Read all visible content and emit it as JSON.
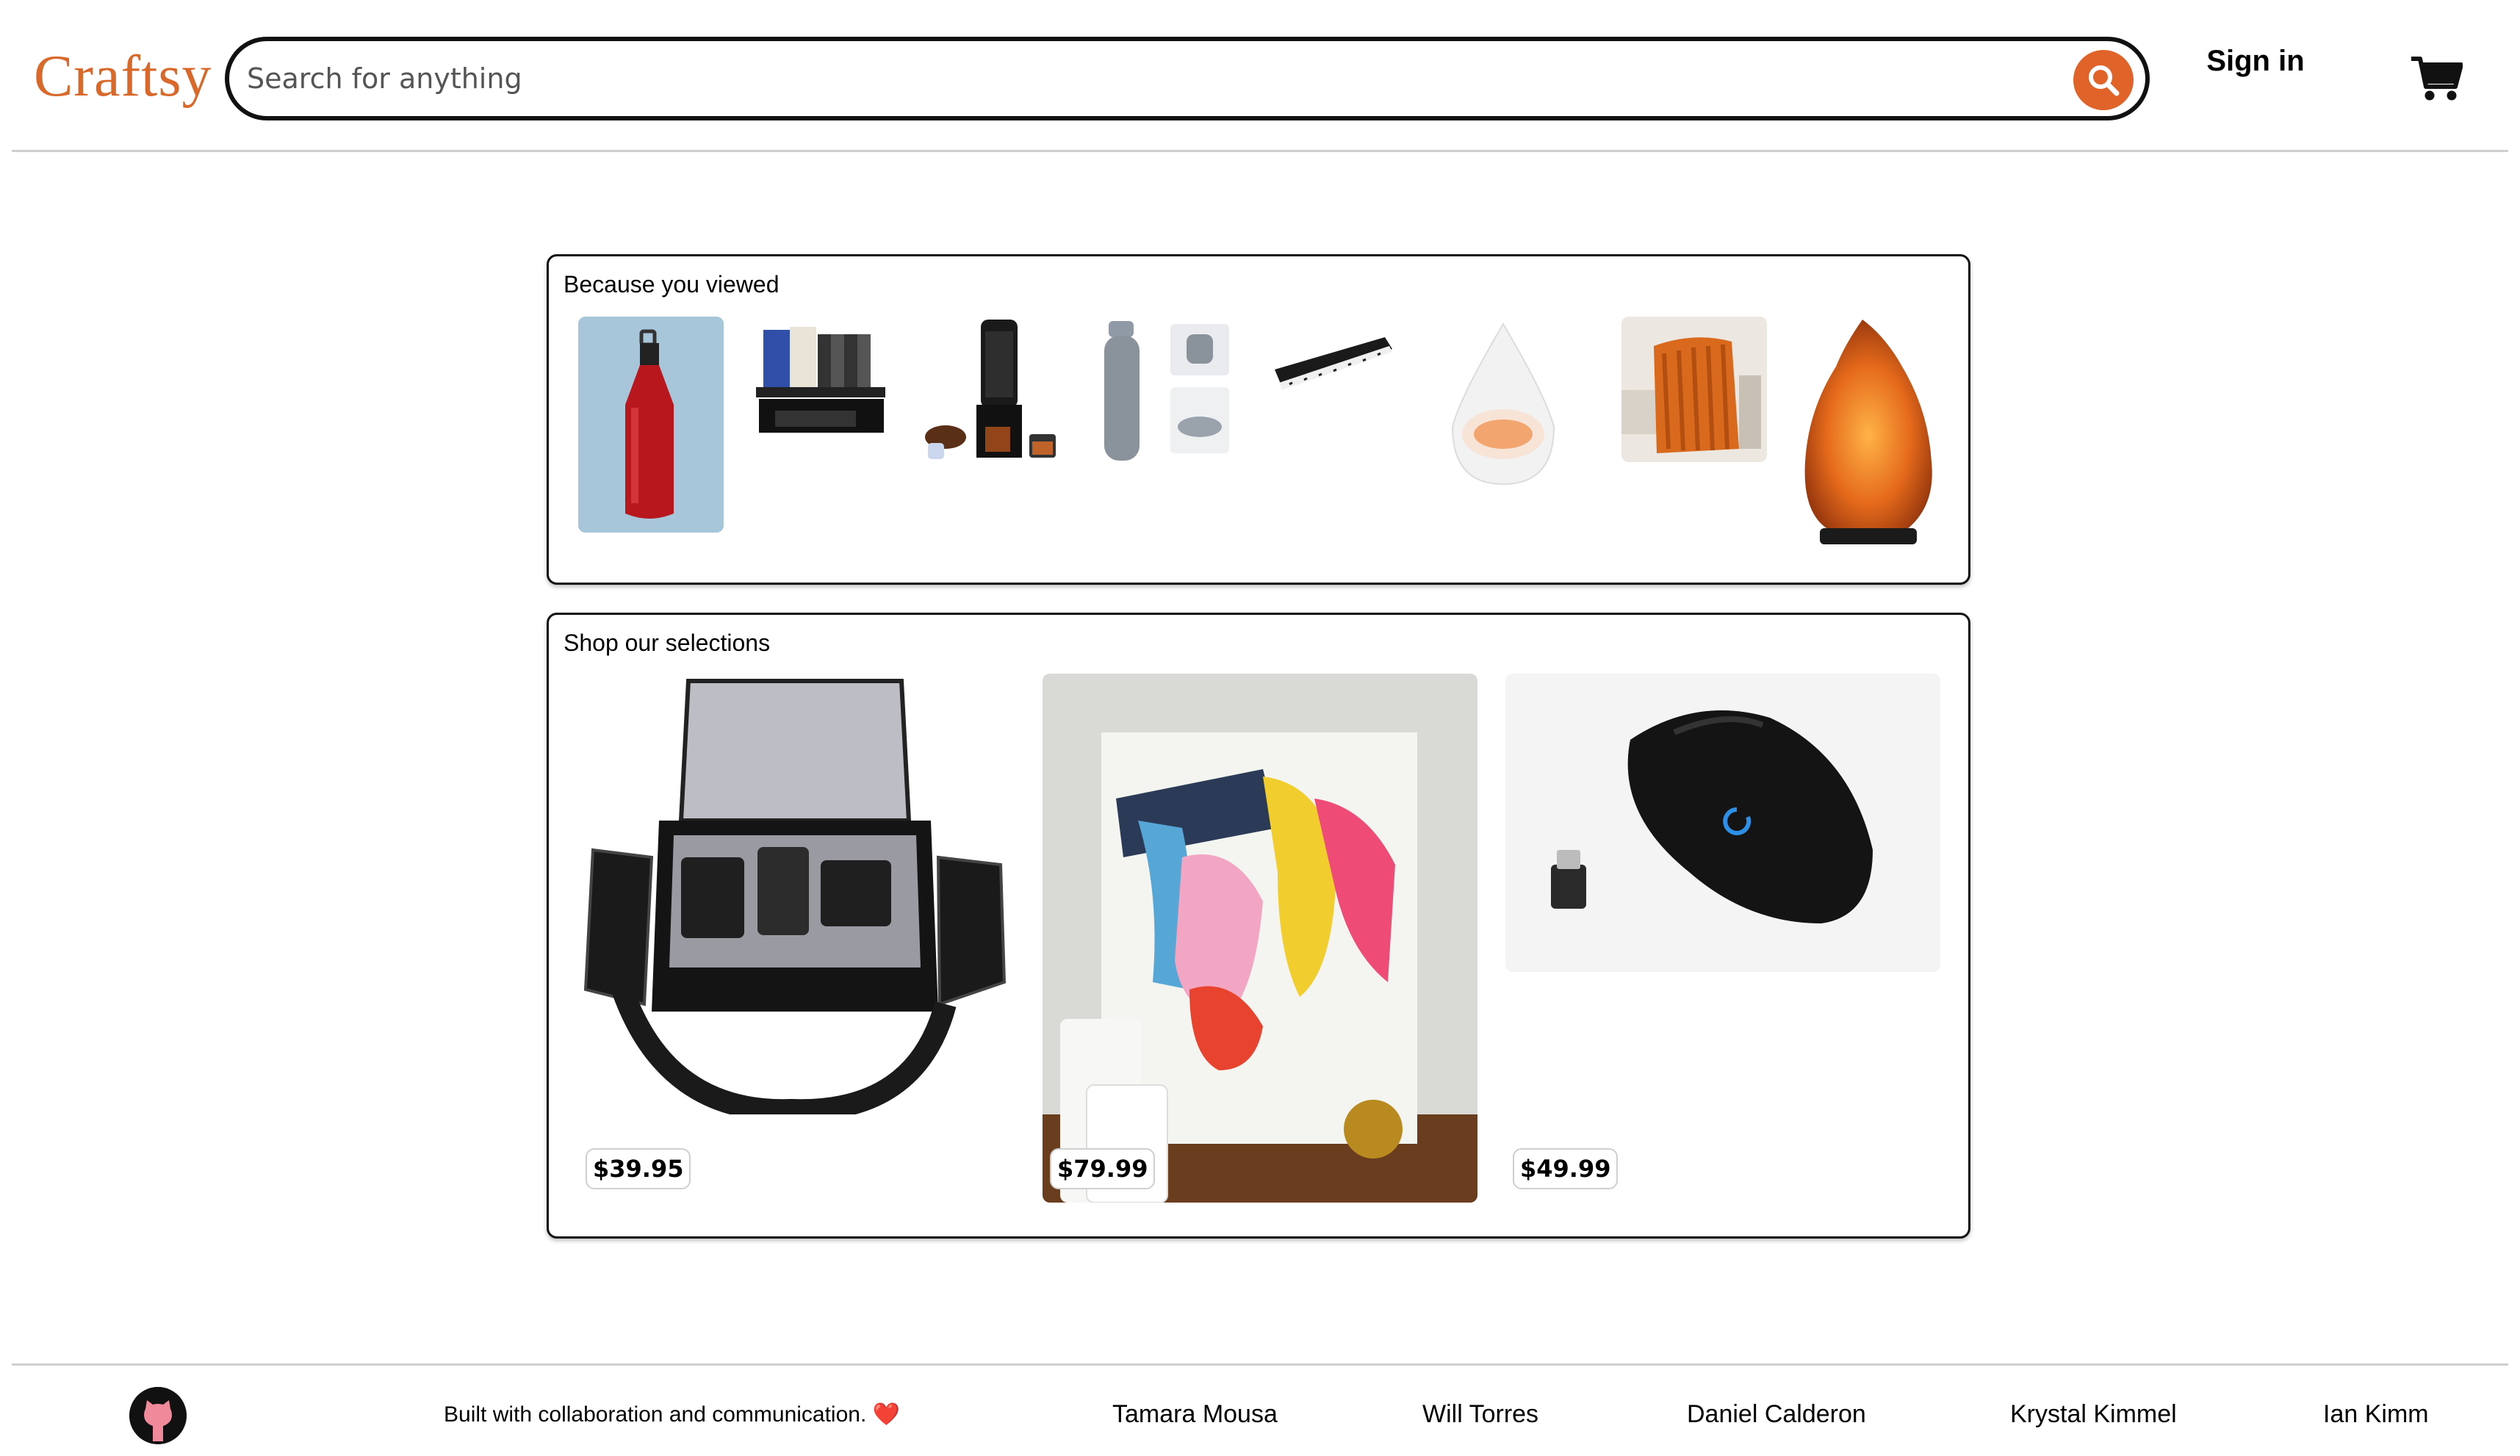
{
  "header": {
    "logo": "Craftsy",
    "search_placeholder": "Search for anything",
    "signin_label": "Sign in"
  },
  "recent": {
    "title": "Because you viewed",
    "items": [
      {
        "name": "red-water-bottle"
      },
      {
        "name": "desk-organizer"
      },
      {
        "name": "espresso-maker"
      },
      {
        "name": "collapsible-bottle"
      },
      {
        "name": "digital-piano"
      },
      {
        "name": "diffuser"
      },
      {
        "name": "orange-blanket"
      },
      {
        "name": "salt-lamp"
      }
    ]
  },
  "selections": {
    "title": "Shop our selections",
    "items": [
      {
        "name": "camera-bag",
        "price": "$39.95"
      },
      {
        "name": "abstract-painting",
        "price": "$79.99"
      },
      {
        "name": "gaming-mouse",
        "price": "$49.99"
      }
    ]
  },
  "footer": {
    "tagline": "Built with collaboration and communication. ❤️",
    "members": [
      "Tamara Mousa",
      "Will Torres",
      "Daniel Calderon",
      "Krystal Kimmel",
      "Ian Kimm"
    ]
  },
  "colors": {
    "brand": "#d9682b",
    "search_button": "#e0642a"
  }
}
